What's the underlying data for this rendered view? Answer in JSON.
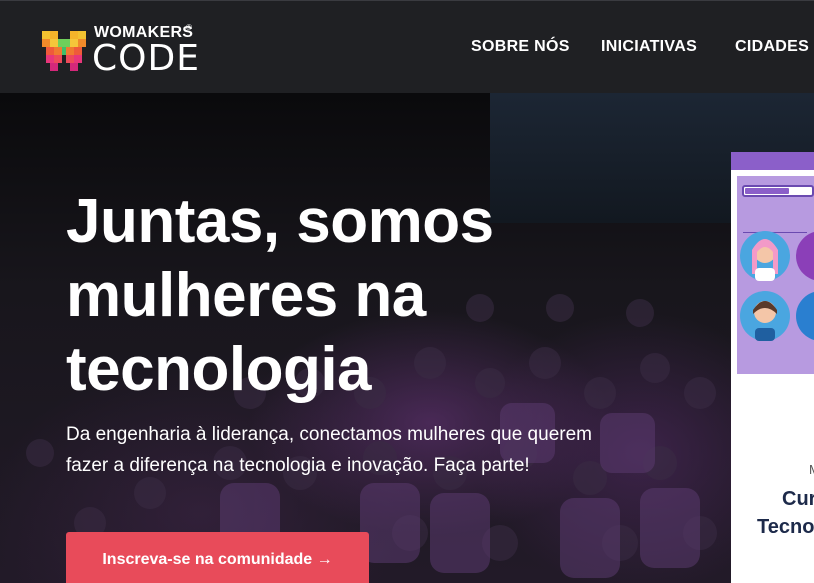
{
  "brand": {
    "name_top": "WOMAKERS",
    "registered": "®",
    "name_bottom": "CODE"
  },
  "nav": {
    "items": [
      {
        "label": "SOBRE NÓS"
      },
      {
        "label": "INICIATIVAS"
      },
      {
        "label": "CIDADES"
      }
    ]
  },
  "hero": {
    "title": "Juntas, somos mulheres na tecnologia",
    "subtitle": "Da engenharia à liderança, conectamos mulheres que querem fazer a diferença na tecnologia e inovação. Faça parte!",
    "cta_label": "Inscreva-se na comunidade →"
  },
  "card": {
    "kicker": "M",
    "title_line1": "Cur",
    "title_line2": "Tecno"
  },
  "colors": {
    "topbar": "#1f2023",
    "cta": "#e84b5a",
    "card_illustration": "#8b5fc9",
    "card_title": "#1d2a4a"
  }
}
